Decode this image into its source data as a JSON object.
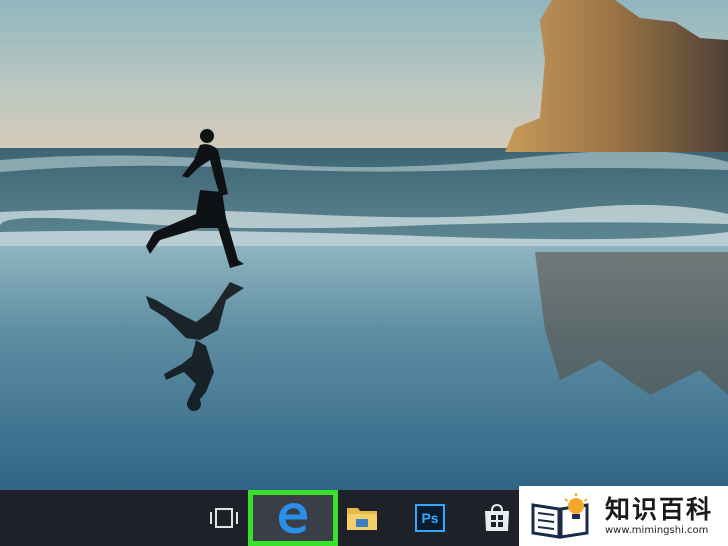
{
  "taskbar": {
    "items": [
      {
        "icon": "task-view-icon"
      },
      {
        "icon": "edge-e-icon",
        "label": "e",
        "highlight_color": "#39e02a"
      },
      {
        "icon": "folder-icon"
      },
      {
        "icon": "photoshop-icon",
        "label": "Ps"
      },
      {
        "icon": "store-icon"
      }
    ]
  },
  "watermark": {
    "title": "知识百科",
    "url": "www.mimingshi.com"
  }
}
